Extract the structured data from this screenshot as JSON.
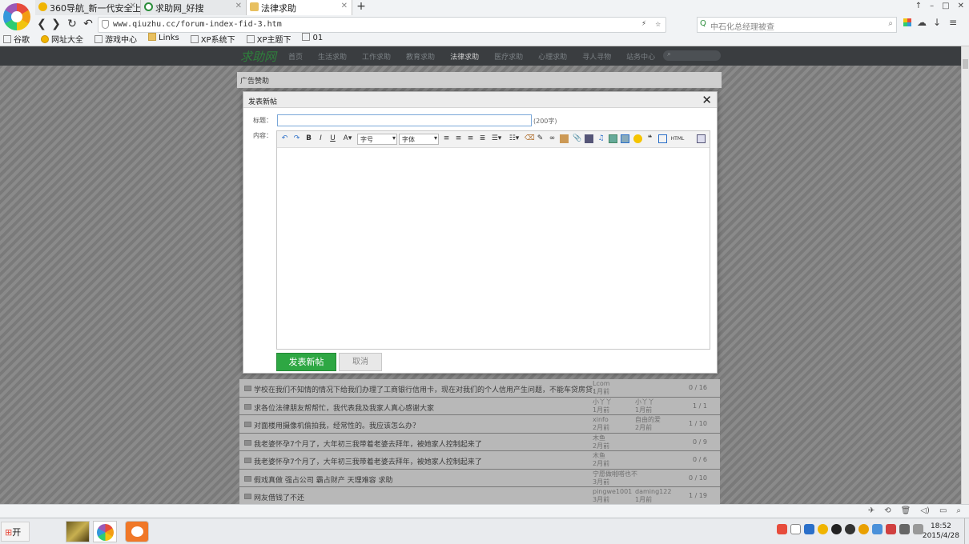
{
  "browser": {
    "tabs": [
      {
        "label": "360导航_新一代安全上",
        "icon_color": "#f0b400",
        "active": false
      },
      {
        "label": "求助网_好搜",
        "icon_color": "#2a8d3a",
        "active": false
      },
      {
        "label": "法律求助",
        "icon_color": "#e8c060",
        "active": true
      }
    ],
    "new_tab_symbol": "+",
    "window_controls": [
      "↑",
      "–",
      "□",
      "✕"
    ],
    "nav_icons": {
      "back": "❮",
      "forward": "❯",
      "reload": "↻",
      "undo": "↶"
    },
    "url": "www.qiuzhu.cc/forum-index-fid-3.htm",
    "search_placeholder": "中石化总经理被查",
    "bookmarks": [
      "谷歌",
      "网址大全",
      "游戏中心",
      "Links",
      "XP系统下",
      "XP主题下",
      "01"
    ],
    "status_icons": [
      "✈",
      "⟲",
      "🗑",
      "◁)",
      "▭",
      "⌕"
    ]
  },
  "site": {
    "logo": "求助网",
    "menu": [
      "首页",
      "生活求助",
      "工作求助",
      "教育求助",
      "法律求助",
      "医疗求助",
      "心理求助",
      "寻人寻物",
      "站务中心"
    ],
    "active_menu_index": 4,
    "ad_label": "广告赞助"
  },
  "modal": {
    "title": "发表新帖",
    "close_symbol": "✕",
    "title_label": "标题：",
    "title_value": "",
    "title_hint": "(200字)",
    "content_label": "内容：",
    "font_size_select": "字号",
    "font_family_select": "字体",
    "submit_label": "发表新帖",
    "cancel_label": "取消"
  },
  "threads": [
    {
      "title": "学校在我们不知情的情况下给我们办理了工商银行信用卡，现在对我们的个人信用产生问题，不能车贷房贷，",
      "author": "Lcom",
      "author_time": "1月前",
      "last": "",
      "last_time": "",
      "replies": "0 / 16"
    },
    {
      "title": "求各位法律朋友帮帮忙，我代表我及我家人真心感谢大家",
      "author": "小丫丫",
      "author_time": "1月前",
      "last": "小丫丫",
      "last_time": "1月前",
      "replies": "1 / 1"
    },
    {
      "title": "对面楼用摄像机偷拍我，经常性的。我应该怎么办？",
      "author": "xinfo",
      "author_time": "2月前",
      "last": "自由的爱",
      "last_time": "2月前",
      "replies": "1 / 10"
    },
    {
      "title": "我老婆怀孕7个月了，大年初三我带着老婆去拜年，被她家人控制起来了",
      "author": "木鱼",
      "author_time": "2月前",
      "last": "",
      "last_time": "",
      "replies": "0 / 9"
    },
    {
      "title": "我老婆怀孕7个月了，大年初三我带着老婆去拜年，被她家人控制起来了",
      "author": "木鱼",
      "author_time": "2月前",
      "last": "",
      "last_time": "",
      "replies": "0 / 6"
    },
    {
      "title": "假戏真做 强占公司 霸占财产 天理难容 求助",
      "author": "宁愿做啪嗒也不",
      "author_time": "3月前",
      "last": "",
      "last_time": "",
      "replies": "0 / 10"
    },
    {
      "title": "网友借钱了不还",
      "author": "pingwe1001",
      "author_time": "3月前",
      "last": "daming122",
      "last_time": "1月前",
      "replies": "1 / 19"
    }
  ],
  "taskbar": {
    "start_label": "开始",
    "clock_time": "18:52",
    "clock_date": "2015/4/28"
  },
  "colors": {
    "submit_green": "#2ea743",
    "page_stripe_dark": "#7a7a7a",
    "nav_dark": "#3a3d40",
    "site_logo_green": "#2f7f3c"
  }
}
